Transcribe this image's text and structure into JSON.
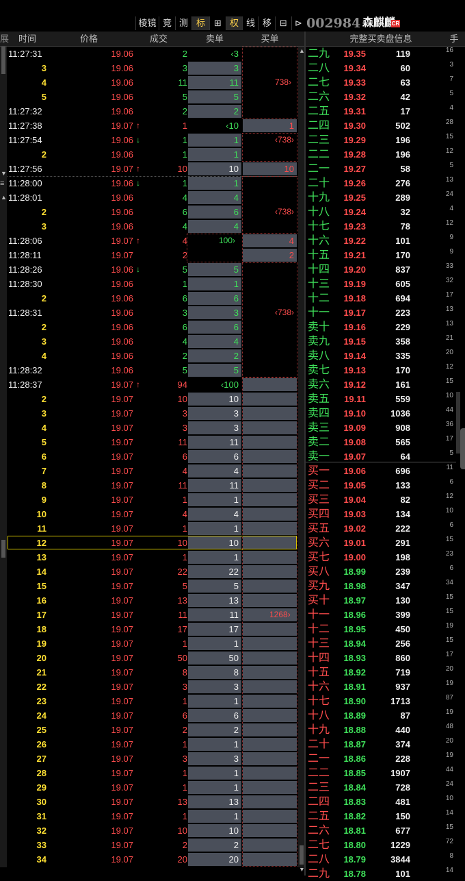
{
  "stock": {
    "code": "002984",
    "name": "森麒麟",
    "badge": "CR"
  },
  "toolbar": [
    "棱镜",
    "竞",
    "测",
    "标",
    "⊞",
    "权",
    "线",
    "移",
    "⊟",
    "⊳"
  ],
  "left_header": {
    "col0": "展",
    "time": "时间",
    "price": "价格",
    "volume": "成交",
    "sell": "卖单",
    "buy": "买单"
  },
  "right_header": {
    "title": "完整买卖盘信息",
    "unit": "手"
  },
  "ticks": [
    {
      "time": "11:27:31",
      "price": "19.06",
      "arrow": "",
      "vol": "2",
      "sell": "3",
      "sell_mark": "‹",
      "buy": ""
    },
    {
      "time": "3",
      "price": "19.06",
      "arrow": "",
      "vol": "3",
      "sell": "3",
      "buy": ""
    },
    {
      "time": "4",
      "price": "19.06",
      "arrow": "",
      "vol": "11",
      "sell": "11",
      "buy": ""
    },
    {
      "time": "5",
      "price": "19.06",
      "arrow": "",
      "vol": "5",
      "sell": "5",
      "buy": ""
    },
    {
      "time": "11:27:32",
      "price": "19.06",
      "arrow": "",
      "vol": "2",
      "sell": "2",
      "buy": ""
    },
    {
      "time": "11:27:38",
      "price": "19.07",
      "arrow": "↑",
      "vol": "1",
      "sell": "10",
      "sell_mark": "‹",
      "buy": "1"
    },
    {
      "time": "11:27:54",
      "price": "19.06",
      "arrow": "↓",
      "vol": "1",
      "sell": "1",
      "buy": ""
    },
    {
      "time": "2",
      "price": "19.06",
      "arrow": "",
      "vol": "1",
      "sell": "1",
      "buy": ""
    },
    {
      "time": "11:27:56",
      "price": "19.07",
      "arrow": "↑",
      "vol": "10",
      "sell": "10",
      "buy": "10"
    },
    {
      "time": "11:28:00",
      "price": "19.06",
      "arrow": "↓",
      "vol": "1",
      "sell": "1",
      "buy": ""
    },
    {
      "time": "11:28:01",
      "price": "19.06",
      "arrow": "",
      "vol": "4",
      "sell": "4",
      "buy": ""
    },
    {
      "time": "2",
      "price": "19.06",
      "arrow": "",
      "vol": "6",
      "sell": "6",
      "buy": ""
    },
    {
      "time": "3",
      "price": "19.06",
      "arrow": "",
      "vol": "4",
      "sell": "4",
      "buy": ""
    },
    {
      "time": "11:28:06",
      "price": "19.07",
      "arrow": "↑",
      "vol": "4",
      "sell": "",
      "buy": "4"
    },
    {
      "time": "11:28:11",
      "price": "19.07",
      "arrow": "",
      "vol": "2",
      "sell": "",
      "buy": "2"
    },
    {
      "time": "11:28:26",
      "price": "19.06",
      "arrow": "↓",
      "vol": "5",
      "sell": "5",
      "buy": ""
    },
    {
      "time": "11:28:30",
      "price": "19.06",
      "arrow": "",
      "vol": "1",
      "sell": "1",
      "buy": ""
    },
    {
      "time": "2",
      "price": "19.06",
      "arrow": "",
      "vol": "6",
      "sell": "6",
      "buy": ""
    },
    {
      "time": "11:28:31",
      "price": "19.06",
      "arrow": "",
      "vol": "3",
      "sell": "3",
      "buy": ""
    },
    {
      "time": "2",
      "price": "19.06",
      "arrow": "",
      "vol": "6",
      "sell": "6",
      "buy": ""
    },
    {
      "time": "3",
      "price": "19.06",
      "arrow": "",
      "vol": "4",
      "sell": "4",
      "buy": ""
    },
    {
      "time": "4",
      "price": "19.06",
      "arrow": "",
      "vol": "2",
      "sell": "2",
      "buy": ""
    },
    {
      "time": "11:28:32",
      "price": "19.06",
      "arrow": "",
      "vol": "5",
      "sell": "5",
      "buy": ""
    },
    {
      "time": "11:28:37",
      "price": "19.07",
      "arrow": "↑",
      "vol": "94",
      "sell": "100",
      "sell_mark": "‹",
      "buy": ""
    },
    {
      "time": "2",
      "price": "19.07",
      "arrow": "",
      "vol": "10",
      "sell": "10",
      "buy": ""
    },
    {
      "time": "3",
      "price": "19.07",
      "arrow": "",
      "vol": "3",
      "sell": "3",
      "buy": ""
    },
    {
      "time": "4",
      "price": "19.07",
      "arrow": "",
      "vol": "3",
      "sell": "3",
      "buy": ""
    },
    {
      "time": "5",
      "price": "19.07",
      "arrow": "",
      "vol": "11",
      "sell": "11",
      "buy": ""
    },
    {
      "time": "6",
      "price": "19.07",
      "arrow": "",
      "vol": "6",
      "sell": "6",
      "buy": ""
    },
    {
      "time": "7",
      "price": "19.07",
      "arrow": "",
      "vol": "4",
      "sell": "4",
      "buy": ""
    },
    {
      "time": "8",
      "price": "19.07",
      "arrow": "",
      "vol": "11",
      "sell": "11",
      "buy": ""
    },
    {
      "time": "9",
      "price": "19.07",
      "arrow": "",
      "vol": "1",
      "sell": "1",
      "buy": ""
    },
    {
      "time": "10",
      "price": "19.07",
      "arrow": "",
      "vol": "4",
      "sell": "4",
      "buy": ""
    },
    {
      "time": "11",
      "price": "19.07",
      "arrow": "",
      "vol": "1",
      "sell": "1",
      "buy": ""
    },
    {
      "time": "12",
      "price": "19.07",
      "arrow": "",
      "vol": "10",
      "sell": "10",
      "buy": ""
    },
    {
      "time": "13",
      "price": "19.07",
      "arrow": "",
      "vol": "1",
      "sell": "1",
      "buy": ""
    },
    {
      "time": "14",
      "price": "19.07",
      "arrow": "",
      "vol": "22",
      "sell": "22",
      "buy": ""
    },
    {
      "time": "15",
      "price": "19.07",
      "arrow": "",
      "vol": "5",
      "sell": "5",
      "buy": ""
    },
    {
      "time": "16",
      "price": "19.07",
      "arrow": "",
      "vol": "13",
      "sell": "13",
      "buy": ""
    },
    {
      "time": "17",
      "price": "19.07",
      "arrow": "",
      "vol": "11",
      "sell": "11",
      "buy": ""
    },
    {
      "time": "18",
      "price": "19.07",
      "arrow": "",
      "vol": "17",
      "sell": "17",
      "buy": ""
    },
    {
      "time": "19",
      "price": "19.07",
      "arrow": "",
      "vol": "1",
      "sell": "1",
      "buy": ""
    },
    {
      "time": "20",
      "price": "19.07",
      "arrow": "",
      "vol": "50",
      "sell": "50",
      "buy": ""
    },
    {
      "time": "21",
      "price": "19.07",
      "arrow": "",
      "vol": "8",
      "sell": "8",
      "buy": ""
    },
    {
      "time": "22",
      "price": "19.07",
      "arrow": "",
      "vol": "3",
      "sell": "3",
      "buy": ""
    },
    {
      "time": "23",
      "price": "19.07",
      "arrow": "",
      "vol": "1",
      "sell": "1",
      "buy": ""
    },
    {
      "time": "24",
      "price": "19.07",
      "arrow": "",
      "vol": "6",
      "sell": "6",
      "buy": ""
    },
    {
      "time": "25",
      "price": "19.07",
      "arrow": "",
      "vol": "2",
      "sell": "2",
      "buy": ""
    },
    {
      "time": "26",
      "price": "19.07",
      "arrow": "",
      "vol": "1",
      "sell": "1",
      "buy": ""
    },
    {
      "time": "27",
      "price": "19.07",
      "arrow": "",
      "vol": "3",
      "sell": "3",
      "buy": ""
    },
    {
      "time": "28",
      "price": "19.07",
      "arrow": "",
      "vol": "1",
      "sell": "1",
      "buy": ""
    },
    {
      "time": "29",
      "price": "19.07",
      "arrow": "",
      "vol": "1",
      "sell": "1",
      "buy": ""
    },
    {
      "time": "30",
      "price": "19.07",
      "arrow": "",
      "vol": "13",
      "sell": "13",
      "buy": ""
    },
    {
      "time": "31",
      "price": "19.07",
      "arrow": "",
      "vol": "1",
      "sell": "1",
      "buy": ""
    },
    {
      "time": "32",
      "price": "19.07",
      "arrow": "",
      "vol": "10",
      "sell": "10",
      "buy": ""
    },
    {
      "time": "33",
      "price": "19.07",
      "arrow": "",
      "vol": "2",
      "sell": "2",
      "buy": ""
    },
    {
      "time": "34",
      "price": "19.07",
      "arrow": "",
      "vol": "20",
      "sell": "20",
      "buy": ""
    }
  ],
  "buy_groups": [
    {
      "label": "738",
      "mark": "›"
    },
    {
      "label": "‹738",
      "mark": "›"
    },
    {
      "label": "‹738",
      "mark": "›"
    },
    {
      "label": "100",
      "mark": "›"
    },
    {
      "label": "‹738",
      "mark": "›"
    },
    {
      "label": "1268",
      "mark": "›"
    }
  ],
  "order_book": [
    {
      "label": "二九",
      "price": "19.35",
      "vol": "119",
      "cnt": "16"
    },
    {
      "label": "二八",
      "price": "19.34",
      "vol": "60",
      "cnt": "3"
    },
    {
      "label": "二七",
      "price": "19.33",
      "vol": "63",
      "cnt": "7"
    },
    {
      "label": "二六",
      "price": "19.32",
      "vol": "42",
      "cnt": "5"
    },
    {
      "label": "二五",
      "price": "19.31",
      "vol": "17",
      "cnt": "4"
    },
    {
      "label": "二四",
      "price": "19.30",
      "vol": "502",
      "cnt": "28"
    },
    {
      "label": "二三",
      "price": "19.29",
      "vol": "196",
      "cnt": "15"
    },
    {
      "label": "二二",
      "price": "19.28",
      "vol": "196",
      "cnt": "12"
    },
    {
      "label": "二一",
      "price": "19.27",
      "vol": "58",
      "cnt": "5"
    },
    {
      "label": "二十",
      "price": "19.26",
      "vol": "276",
      "cnt": "13"
    },
    {
      "label": "十九",
      "price": "19.25",
      "vol": "289",
      "cnt": "24"
    },
    {
      "label": "十八",
      "price": "19.24",
      "vol": "32",
      "cnt": "4"
    },
    {
      "label": "十七",
      "price": "19.23",
      "vol": "78",
      "cnt": "12"
    },
    {
      "label": "十六",
      "price": "19.22",
      "vol": "101",
      "cnt": "9"
    },
    {
      "label": "十五",
      "price": "19.21",
      "vol": "170",
      "cnt": "9"
    },
    {
      "label": "十四",
      "price": "19.20",
      "vol": "837",
      "cnt": "33"
    },
    {
      "label": "十三",
      "price": "19.19",
      "vol": "605",
      "cnt": "32"
    },
    {
      "label": "十二",
      "price": "19.18",
      "vol": "694",
      "cnt": "17"
    },
    {
      "label": "十一",
      "price": "19.17",
      "vol": "223",
      "cnt": "13"
    },
    {
      "label": "卖十",
      "price": "19.16",
      "vol": "229",
      "cnt": "13"
    },
    {
      "label": "卖九",
      "price": "19.15",
      "vol": "358",
      "cnt": "21"
    },
    {
      "label": "卖八",
      "price": "19.14",
      "vol": "335",
      "cnt": "20"
    },
    {
      "label": "卖七",
      "price": "19.13",
      "vol": "170",
      "cnt": "12"
    },
    {
      "label": "卖六",
      "price": "19.12",
      "vol": "161",
      "cnt": "15"
    },
    {
      "label": "卖五",
      "price": "19.11",
      "vol": "559",
      "cnt": "10"
    },
    {
      "label": "卖四",
      "price": "19.10",
      "vol": "1036",
      "cnt": "44"
    },
    {
      "label": "卖三",
      "price": "19.09",
      "vol": "908",
      "cnt": "36"
    },
    {
      "label": "卖二",
      "price": "19.08",
      "vol": "565",
      "cnt": "17"
    },
    {
      "label": "卖一",
      "price": "19.07",
      "vol": "64",
      "cnt": "5"
    },
    {
      "label": "买一",
      "price": "19.06",
      "vol": "696",
      "cnt": "11"
    },
    {
      "label": "买二",
      "price": "19.05",
      "vol": "133",
      "cnt": "6"
    },
    {
      "label": "买三",
      "price": "19.04",
      "vol": "82",
      "cnt": "12"
    },
    {
      "label": "买四",
      "price": "19.03",
      "vol": "134",
      "cnt": "10"
    },
    {
      "label": "买五",
      "price": "19.02",
      "vol": "222",
      "cnt": "6"
    },
    {
      "label": "买六",
      "price": "19.01",
      "vol": "291",
      "cnt": "15"
    },
    {
      "label": "买七",
      "price": "19.00",
      "vol": "198",
      "cnt": "23"
    },
    {
      "label": "买八",
      "price": "18.99",
      "vol": "239",
      "cnt": "6"
    },
    {
      "label": "买九",
      "price": "18.98",
      "vol": "347",
      "cnt": "34"
    },
    {
      "label": "买十",
      "price": "18.97",
      "vol": "130",
      "cnt": "15"
    },
    {
      "label": "十一",
      "price": "18.96",
      "vol": "399",
      "cnt": "15"
    },
    {
      "label": "十二",
      "price": "18.95",
      "vol": "450",
      "cnt": "19"
    },
    {
      "label": "十三",
      "price": "18.94",
      "vol": "256",
      "cnt": "15"
    },
    {
      "label": "十四",
      "price": "18.93",
      "vol": "860",
      "cnt": "17"
    },
    {
      "label": "十五",
      "price": "18.92",
      "vol": "719",
      "cnt": "20"
    },
    {
      "label": "十六",
      "price": "18.91",
      "vol": "937",
      "cnt": "19"
    },
    {
      "label": "十七",
      "price": "18.90",
      "vol": "1713",
      "cnt": "87"
    },
    {
      "label": "十八",
      "price": "18.89",
      "vol": "87",
      "cnt": "19"
    },
    {
      "label": "十九",
      "price": "18.88",
      "vol": "440",
      "cnt": "48"
    },
    {
      "label": "二十",
      "price": "18.87",
      "vol": "374",
      "cnt": "20"
    },
    {
      "label": "二一",
      "price": "18.86",
      "vol": "228",
      "cnt": "19"
    },
    {
      "label": "二二",
      "price": "18.85",
      "vol": "1907",
      "cnt": "44"
    },
    {
      "label": "二三",
      "price": "18.84",
      "vol": "728",
      "cnt": "24"
    },
    {
      "label": "二四",
      "price": "18.83",
      "vol": "481",
      "cnt": "10"
    },
    {
      "label": "二五",
      "price": "18.82",
      "vol": "150",
      "cnt": "14"
    },
    {
      "label": "二六",
      "price": "18.81",
      "vol": "677",
      "cnt": "15"
    },
    {
      "label": "二七",
      "price": "18.80",
      "vol": "1229",
      "cnt": "72"
    },
    {
      "label": "二八",
      "price": "18.79",
      "vol": "3844",
      "cnt": "8"
    },
    {
      "label": "二九",
      "price": "18.78",
      "vol": "101",
      "cnt": "14"
    }
  ],
  "colors": {
    "up": "#ff4d4d",
    "down": "#3fe05a",
    "seq": "#ffe033",
    "fill": "#4a4f5a"
  }
}
